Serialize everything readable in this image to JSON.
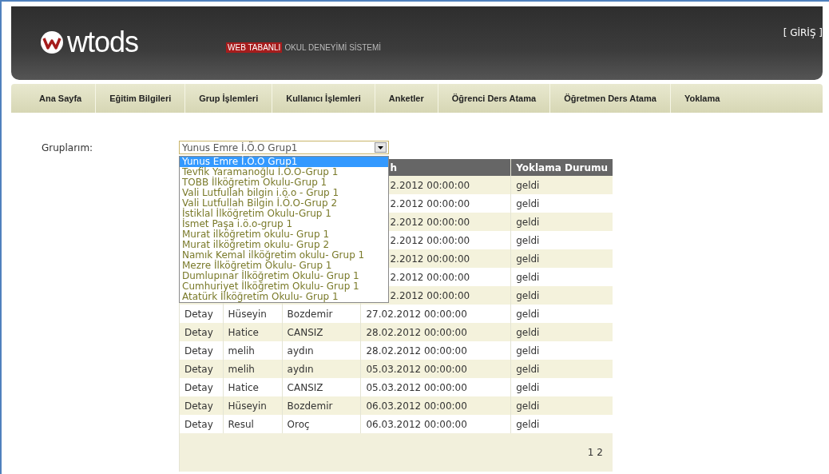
{
  "header": {
    "logo_text": "wtods",
    "tagline_highlight": "WEB TABANLI",
    "tagline": "OKUL DENEYİMİ SİSTEMİ",
    "login": "[ GİRİŞ ]"
  },
  "nav": [
    "Ana Sayfa",
    "Eğitim Bilgileri",
    "Grup İşlemleri",
    "Kullanıcı İşlemleri",
    "Anketler",
    "Öğrenci Ders Atama",
    "Öğretmen Ders Atama",
    "Yoklama"
  ],
  "group_label": "Gruplarım:",
  "group_select": {
    "value": "Yunus Emre İ.Ö.O Grup1",
    "expanded": true,
    "options": [
      {
        "label": "Yunus Emre İ.Ö.O Grup1",
        "selected": true
      },
      {
        "label": "Tevfik Yaramanoğlu İ.Ö.O-Grup 1",
        "selected": false
      },
      {
        "label": "TOBB İlköğretim Okulu-Grup 1",
        "selected": false
      },
      {
        "label": "Vali Lutfullah bilgin i.ö.o - Grup 1",
        "selected": false
      },
      {
        "label": "Vali Lutfullah Bilgin İ.Ö.O-Grup 2",
        "selected": false
      },
      {
        "label": "İstiklal İlköğretim Okulu-Grup 1",
        "selected": false
      },
      {
        "label": "İsmet Paşa i.ö.o-grup 1",
        "selected": false
      },
      {
        "label": "Murat ilköğretim okulu- Grup 1",
        "selected": false
      },
      {
        "label": "Murat ilköğretim okulu- Grup 2",
        "selected": false
      },
      {
        "label": "Namık Kemal ilköğretim okulu- Grup 1",
        "selected": false
      },
      {
        "label": "Mezre İlköğretim Okulu- Grup 1",
        "selected": false
      },
      {
        "label": "Dumlupınar İlköğretim Okulu- Grup 1",
        "selected": false
      },
      {
        "label": "Cumhuriyet İlköğretim Okulu- Grup 1",
        "selected": false
      },
      {
        "label": "Atatürk İlköğretim Okulu- Grup 1",
        "selected": false
      }
    ]
  },
  "table": {
    "columns": [
      "h",
      "Yoklama Durumu"
    ],
    "rows": [
      {
        "kind": "partial",
        "date": "2.2012 00:00:00",
        "status": "geldi"
      },
      {
        "kind": "partial",
        "date": "2.2012 00:00:00",
        "status": "geldi"
      },
      {
        "kind": "partial",
        "date": "2.2012 00:00:00",
        "status": "geldi"
      },
      {
        "kind": "partial",
        "date": "2.2012 00:00:00",
        "status": "geldi"
      },
      {
        "kind": "partial",
        "date": "2.2012 00:00:00",
        "status": "geldi"
      },
      {
        "kind": "partial",
        "date": "2.2012 00:00:00",
        "status": "geldi"
      },
      {
        "kind": "partial",
        "date": "2.2012 00:00:00",
        "status": "geldi"
      },
      {
        "kind": "full",
        "link": "Detay",
        "first_name": "Hüseyin",
        "last_name": "Bozdemir",
        "date": "27.02.2012 00:00:00",
        "status": "geldi"
      },
      {
        "kind": "full",
        "link": "Detay",
        "first_name": "Hatice",
        "last_name": "CANSIZ",
        "date": "28.02.2012 00:00:00",
        "status": "geldi"
      },
      {
        "kind": "full",
        "link": "Detay",
        "first_name": "melih",
        "last_name": "aydın",
        "date": "28.02.2012 00:00:00",
        "status": "geldi"
      },
      {
        "kind": "full",
        "link": "Detay",
        "first_name": "melih",
        "last_name": "aydın",
        "date": "05.03.2012 00:00:00",
        "status": "geldi"
      },
      {
        "kind": "full",
        "link": "Detay",
        "first_name": "Hatice",
        "last_name": "CANSIZ",
        "date": "05.03.2012 00:00:00",
        "status": "geldi"
      },
      {
        "kind": "full",
        "link": "Detay",
        "first_name": "Hüseyin",
        "last_name": "Bozdemir",
        "date": "06.03.2012 00:00:00",
        "status": "geldi"
      },
      {
        "kind": "full",
        "link": "Detay",
        "first_name": "Resul",
        "last_name": "Oroç",
        "date": "06.03.2012 00:00:00",
        "status": "geldi"
      }
    ],
    "pages": [
      "1",
      "2"
    ]
  }
}
